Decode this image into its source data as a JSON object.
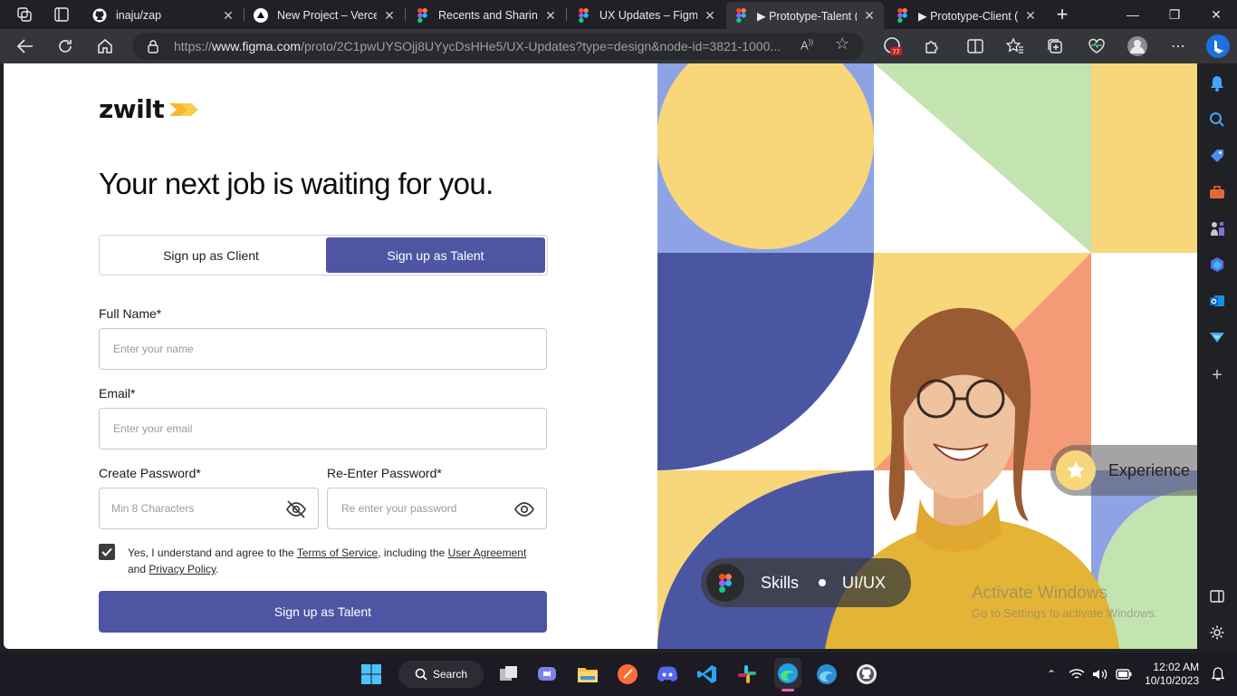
{
  "browser": {
    "tabs": [
      {
        "label": "inaju/zap",
        "icon": "github-icon"
      },
      {
        "label": "New Project – Vercel",
        "icon": "vercel-icon"
      },
      {
        "label": "Recents and Sharing",
        "icon": "figma-icon"
      },
      {
        "label": "UX Updates – Figma",
        "icon": "figma-icon"
      },
      {
        "label": "▶ Prototype-Talent (Fi",
        "icon": "figma-icon",
        "active": true
      },
      {
        "label": "▶ Prototype-Client (F",
        "icon": "figma-icon"
      }
    ],
    "url_prefix": "https://",
    "url_host": "www.figma.com",
    "url_path": "/proto/2C1pwUYSOjj8UYycDsHHe5/UX-Updates?type=design&node-id=3821-1000...",
    "extension_badge": "77"
  },
  "page": {
    "logo_text": "zwilt",
    "headline": "Your next job is waiting for you.",
    "toggle": {
      "client_label": "Sign up as Client",
      "talent_label": "Sign up as Talent",
      "selected": "talent"
    },
    "full_name": {
      "label": "Full Name*",
      "placeholder": "Enter your name"
    },
    "email": {
      "label": "Email*",
      "placeholder": "Enter your email"
    },
    "password": {
      "label": "Create Password*",
      "placeholder": "Min 8 Characters"
    },
    "reenter": {
      "label": "Re-Enter Password*",
      "placeholder": "Re enter your password"
    },
    "terms": {
      "checked": true,
      "prefix": "Yes, I understand and agree to the ",
      "tos": "Terms of Service",
      "mid": ", including the ",
      "ua": "User Agreement",
      "and": "and ",
      "pp": "Privacy Policy",
      "end": "."
    },
    "submit_label": "Sign up as Talent",
    "art": {
      "experience_label": "Experience",
      "skills_label": "Skills",
      "skills_value": "UI/UX"
    },
    "watermark": {
      "title": "Activate Windows",
      "subtitle": "Go to Settings to activate Windows."
    },
    "colors": {
      "primary": "#4e56a4",
      "yellow": "#f8d67a",
      "green": "#c3e3b0",
      "periwinkle": "#8ea2e6",
      "salmon": "#f49a77"
    }
  },
  "taskbar": {
    "search_label": "Search",
    "time": "12:02 AM",
    "date": "10/10/2023"
  }
}
